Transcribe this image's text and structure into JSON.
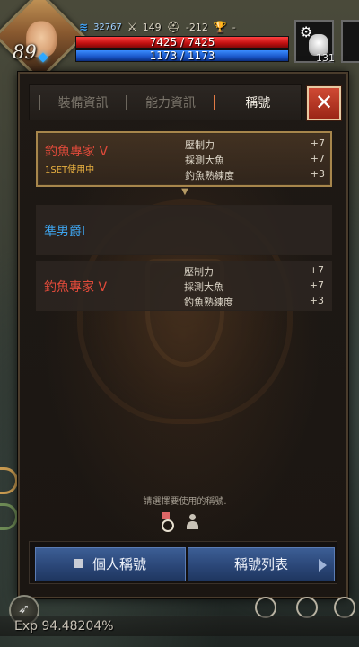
{
  "hud": {
    "level": "89",
    "mana_points": "32767",
    "attack": "149",
    "defense": "-212",
    "trophy": "-",
    "hp_text": "7425 / 7425",
    "mp_text": "1173 / 1173",
    "bag_count": "131",
    "icons": [
      "mana-icon",
      "sword-icon",
      "helmet-icon",
      "trophy-icon",
      "gear-icon",
      "bag-icon"
    ]
  },
  "tabs": [
    {
      "label": "裝備資訊",
      "active": false
    },
    {
      "label": "能力資訊",
      "active": false
    },
    {
      "label": "稱號",
      "active": true
    }
  ],
  "close_label": "✕",
  "titles": [
    {
      "name": "釣魚專家 V",
      "status": "1SET使用中",
      "selected": true,
      "stats": [
        {
          "label": "壓制力",
          "value": "+7"
        },
        {
          "label": "採測大魚",
          "value": "+7"
        },
        {
          "label": "釣魚熟練度",
          "value": "+3"
        }
      ]
    },
    {
      "name": "準男爵I",
      "status": "",
      "selected": false,
      "stats": []
    },
    {
      "name": "釣魚專家 V",
      "status": "",
      "selected": false,
      "stats": [
        {
          "label": "壓制力",
          "value": "+7"
        },
        {
          "label": "採測大魚",
          "value": "+7"
        },
        {
          "label": "釣魚熟練度",
          "value": "+3"
        }
      ]
    }
  ],
  "hint": "請選擇要使用的稱號.",
  "buttons": {
    "personal": "個人稱號",
    "list": "稱號列表"
  },
  "exp_text": "Exp  94.48204%",
  "colors": {
    "title_red": "#e04a3a",
    "title_blue": "#3ea4ee",
    "status_gold": "#e8b040",
    "hp_red": "#c01010",
    "mp_blue": "#1a56c8",
    "button_blue": "#2b4778",
    "close_red": "#b53420"
  }
}
